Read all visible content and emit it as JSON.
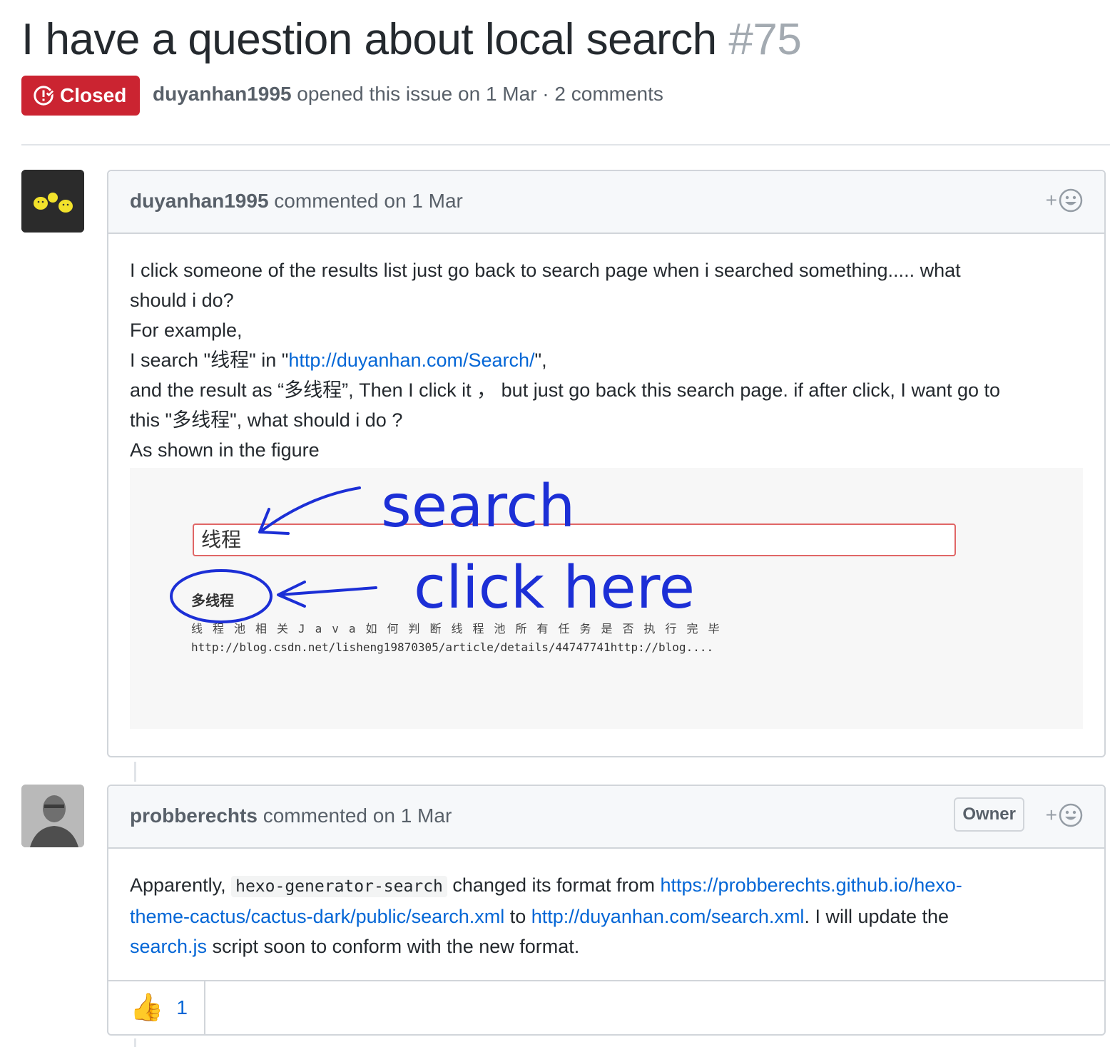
{
  "issue": {
    "title": "I have a question about local search",
    "number": "#75",
    "state": "Closed",
    "state_color": "#cb2431",
    "author": "duyanhan1995",
    "meta_text": " opened this issue on 1 Mar · 2 comments"
  },
  "comments": [
    {
      "author": "duyanhan1995",
      "action": " commented on 1 Mar",
      "avatar_icon": "yellow-ducks-avatar",
      "body": {
        "line1": "I click someone of the results list just go back to search page when i searched something..... what",
        "line2": "should i do?",
        "line3": "For example,",
        "line4_pre": "I search \"线程\" in \"",
        "line4_link": "http://duyanhan.com/Search/",
        "line4_post": "\",",
        "line5": "and the result as “多线程”, Then I click it ， but just go back this search page. if after click, I want go to",
        "line6": "this \"多线程\", what should i do ?",
        "line7": "As shown in the figure"
      },
      "figure": {
        "input_value": "线程",
        "result_title": "多线程",
        "snippet": "线程池相关Java如何判断线程池所有任务是否执行完毕",
        "url_text": "http://blog.csdn.net/lisheng19870305/article/details/44747741http://blog....",
        "annotation_search": "search",
        "annotation_click": "click here",
        "ink_color": "#1c2fd6"
      }
    },
    {
      "author": "probberechts",
      "action": " commented on 1 Mar",
      "badge": "Owner",
      "avatar_icon": "person-photo-avatar",
      "body": {
        "p1_pre": "Apparently, ",
        "code": "hexo-generator-search",
        "p1_mid": " changed its format from ",
        "link1_part1": "https://probberechts.github.io/hexo-",
        "link1_part2": "theme-cactus/cactus-dark/public/search.xml",
        "p2_mid": " to ",
        "link2": "http://duyanhan.com/search.xml",
        "p2_post": ". I will update the",
        "link3": "search.js",
        "p3_post": " script soon to conform with the new format."
      },
      "reactions": [
        {
          "emoji": "👍",
          "icon": "thumbs-up-icon",
          "count": "1"
        }
      ]
    }
  ],
  "colors": {
    "link": "#0366d6",
    "muted": "#586069",
    "border": "#d1d5da"
  }
}
